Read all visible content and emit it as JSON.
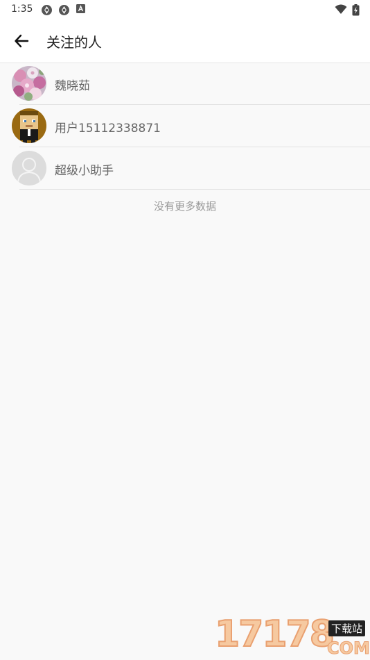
{
  "status_bar": {
    "time": "1:35"
  },
  "header": {
    "title": "关注的人"
  },
  "following": [
    {
      "name": "魏晓茹",
      "avatar": "flower-photo-avatar"
    },
    {
      "name": "用户15112338871",
      "avatar": "pixel-character-avatar"
    },
    {
      "name": "超级小助手",
      "avatar": "default-user-avatar"
    }
  ],
  "footer_text": "没有更多数据",
  "watermark": {
    "number": "17178",
    "tag": "下载站",
    "suffix": "COM"
  },
  "colors": {
    "background": "#f9f9f9",
    "header_bg": "#ffffff",
    "text_primary": "#222222",
    "text_secondary": "#666666",
    "text_muted": "#999999",
    "divider": "#e2e2e2"
  }
}
